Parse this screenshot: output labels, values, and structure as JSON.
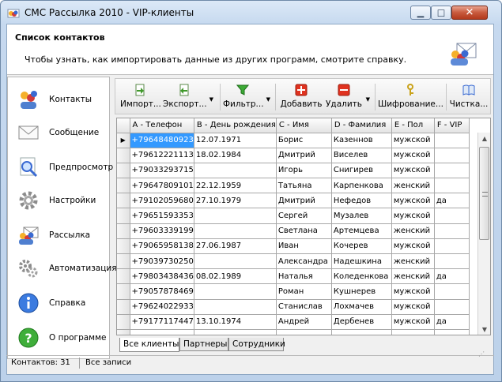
{
  "window": {
    "title": "СМС Рассылка 2010 - VIP-клиенты"
  },
  "header": {
    "title": "Список контактов",
    "subtitle": "Чтобы узнать, как импортировать данные из других программ, смотрите справку."
  },
  "sidebar": {
    "items": [
      {
        "label": "Контакты",
        "icon": "contacts-icon"
      },
      {
        "label": "Сообщение",
        "icon": "envelope-icon"
      },
      {
        "label": "Предпросмотр",
        "icon": "magnifier-icon"
      },
      {
        "label": "Настройки",
        "icon": "gear-icon"
      },
      {
        "label": "Рассылка",
        "icon": "mailing-icon"
      },
      {
        "label": "Автоматизация",
        "icon": "gears-icon"
      },
      {
        "label": "Справка",
        "icon": "info-icon"
      },
      {
        "label": "О программе",
        "icon": "help-icon"
      }
    ]
  },
  "toolbar": {
    "import": "Импорт...",
    "export": "Экспорт...",
    "filter": "Фильтр...",
    "add": "Добавить",
    "delete": "Удалить",
    "encrypt": "Шифрование...",
    "clean": "Чистка..."
  },
  "grid": {
    "columns": [
      "A - Телефон",
      "B - День рождения",
      "C - Имя",
      "D - Фамилия",
      "E - Пол",
      "F - VIP"
    ],
    "rows": [
      [
        "+79648480923",
        "12.07.1971",
        "Борис",
        "Казеннов",
        "мужской",
        ""
      ],
      [
        "+79612221113",
        "18.02.1984",
        "Дмитрий",
        "Виселев",
        "мужской",
        ""
      ],
      [
        "+79033293715",
        "",
        "Игорь",
        "Снигирев",
        "мужской",
        ""
      ],
      [
        "+79647809101",
        "22.12.1959",
        "Татьяна",
        "Карпенкова",
        "женский",
        ""
      ],
      [
        "+79102059680",
        "27.10.1979",
        "Дмитрий",
        "Нефедов",
        "мужской",
        "да"
      ],
      [
        "+79651593353",
        "",
        "Сергей",
        "Музалев",
        "мужской",
        ""
      ],
      [
        "+79603339199",
        "",
        "Светлана",
        "Артемцева",
        "женский",
        ""
      ],
      [
        "+79065958138",
        "27.06.1987",
        "Иван",
        "Кочерев",
        "мужской",
        ""
      ],
      [
        "+79039730250",
        "",
        "Александра",
        "Надешкина",
        "женский",
        ""
      ],
      [
        "+79803438436",
        "08.02.1989",
        "Наталья",
        "Коледенкова",
        "женский",
        "да"
      ],
      [
        "+79057878469",
        "",
        "Роман",
        "Кушнерев",
        "мужской",
        ""
      ],
      [
        "+79624022933",
        "",
        "Станислав",
        "Лохмачев",
        "мужской",
        ""
      ],
      [
        "+79177117447",
        "13.10.1974",
        "Андрей",
        "Дербенев",
        "мужской",
        "да"
      ],
      [
        "",
        "",
        "",
        "",
        "",
        ""
      ]
    ],
    "selected_row": 0
  },
  "tabs": [
    "Все клиенты",
    "Партнеры",
    "Сотрудники"
  ],
  "status": {
    "contacts": "Контактов: 31",
    "filter": "Все записи"
  }
}
